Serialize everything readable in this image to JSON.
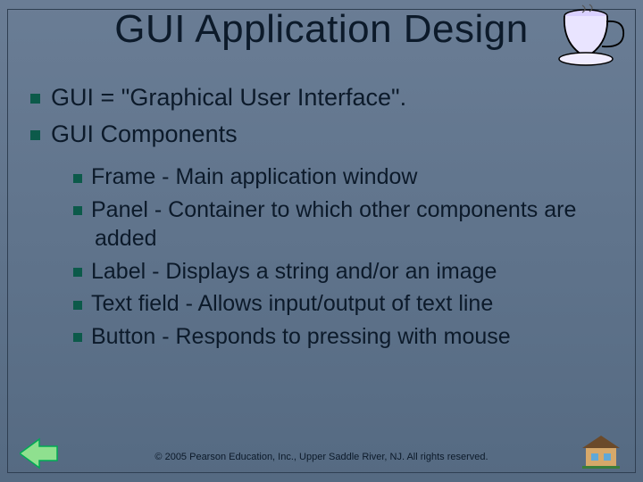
{
  "title": "GUI Application Design",
  "bullets_lvl1": [
    "GUI = \"Graphical User Interface\".",
    "GUI Components"
  ],
  "bullets_lvl2": [
    "Frame - Main application window",
    "Panel - Container to which other components are added",
    "Label - Displays a string and/or an image",
    "Text field - Allows input/output of text line",
    "Button - Responds to pressing with mouse"
  ],
  "footer": "© 2005 Pearson Education, Inc., Upper Saddle River, NJ.  All rights reserved.",
  "decor": {
    "cup_icon": "coffee-cup",
    "nav_left": "prev-arrow",
    "nav_right": "home-building"
  },
  "colors": {
    "bullet": "#0c5a4a",
    "bg_top": "#6a7d95",
    "bg_bottom": "#556a82"
  }
}
